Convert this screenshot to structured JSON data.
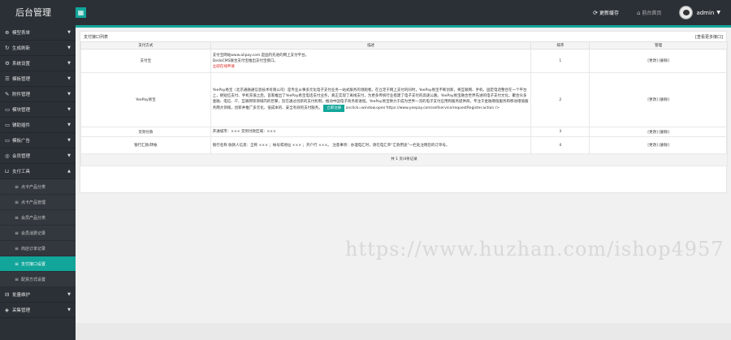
{
  "header": {
    "brand": "后台管理",
    "grid_icon": "grid-icon",
    "update_cache": "更新缓存",
    "home": "前台首页",
    "user": "admin"
  },
  "sidebar": {
    "items": [
      {
        "icon": "globe-icon",
        "label": "模型表单"
      },
      {
        "icon": "refresh-icon",
        "label": "生成刷新"
      },
      {
        "icon": "gear-icon",
        "label": "系统设置"
      },
      {
        "icon": "list-icon",
        "label": "模板管理"
      },
      {
        "icon": "puzzle-icon",
        "label": "附件管理"
      },
      {
        "icon": "folder-icon",
        "label": "模块管理"
      },
      {
        "icon": "folder-icon",
        "label": "辅助插件"
      },
      {
        "icon": "folder-icon",
        "label": "模板广告"
      },
      {
        "icon": "user-icon",
        "label": "会员管理"
      },
      {
        "icon": "cart-icon",
        "label": "支付工具"
      }
    ],
    "subitems": [
      {
        "label": "点卡产品分类"
      },
      {
        "label": "点卡产品管理"
      },
      {
        "label": "会员产品分类"
      },
      {
        "label": "会员消费记录"
      },
      {
        "label": "商店订单记录"
      },
      {
        "label": "支付接口设置"
      },
      {
        "label": "配货方式设置"
      }
    ],
    "bottom_items": [
      {
        "icon": "archive-icon",
        "label": "批量维护"
      },
      {
        "icon": "collect-icon",
        "label": "采集管理"
      }
    ]
  },
  "panel": {
    "title": "支付接口列表",
    "more": "[查看更多接口]",
    "columns": [
      "支付方式",
      "描述",
      "排序",
      "管理"
    ],
    "rows": [
      {
        "name": "支付宝",
        "desc": [
          "支付宝网站www.alipay.com 是国内先进的网上支付平台。",
          "DedeCMS联合支付宝推出支付宝接口。",
          "立即在线申请"
        ],
        "order": "1",
        "manage": "[更改] [删除]"
      },
      {
        "name": "YeePay易宝",
        "desc": [
          "YeePay易宝（北京通融通信息技术有限公司）是专业从事多元化电子支付业务一站式服务的领跑者。在立足于网上支付的同时，YeePay易宝不断创新，将互联网、手机、固定电话整合在一个平台上，继短信支付、手机充值之后，首家推出了YeePay易宝电话支付业务，真正实现了离线支付，为更多传统行业搭建了电子支付的高速公路。YeePay易宝融合世界先进的电子支付文化，聚合众多金融、电信、IT、互联网等领域内的巨擘，旨在通过创新的支付机制，推动中国电子商务新进程。YeePay易宝致力于成为世界一流的电子支付应用和服务提供商，专注于金融增值服务和移动增值服务两大领域，创新并推广多元化、低成本的、安全有效的支付服务。",
          "立即注册",
          "onclick=window.open'https://www.yeepay.com/selfservice/requestRegister.action /> "
        ],
        "order": "2",
        "manage": "[更改] [删除]"
      },
      {
        "name": "货到付款",
        "desc": [
          "开通城市：××× 货到付款区域：×××"
        ],
        "order": "3",
        "manage": "[更改] [删除]"
      },
      {
        "name": "银行汇款/转帐",
        "desc": [
          "银行名称 收款人信息：全称 ××× ；帐号或地址 ××× ；开户行 ×××。 注意事项：办理电汇时，请在电汇单“汇款用途”一栏处注明您的订单号。"
        ],
        "order": "4",
        "manage": "[更改] [删除]"
      }
    ],
    "pager": "共 1 页/4条记录"
  },
  "watermark": "https://www.huzhan.com/ishop4957"
}
